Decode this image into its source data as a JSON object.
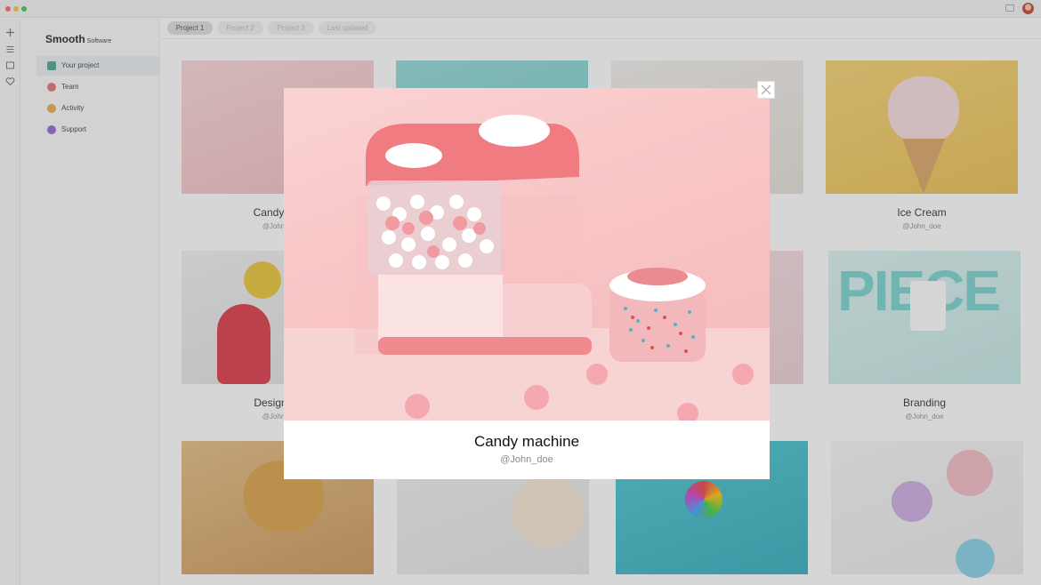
{
  "app": {
    "logo_text": "Smooth",
    "logo_sub": "Software"
  },
  "titlebar": {
    "mail_icon": "mail-icon",
    "avatar_icon": "user-avatar"
  },
  "rail": {
    "icons": [
      "plus-icon",
      "menu-icon",
      "square-icon",
      "heart-icon"
    ]
  },
  "sidebar": {
    "items": [
      {
        "label": "Your project",
        "icon": "briefcase-icon",
        "color": "#3aa28c"
      },
      {
        "label": "Team",
        "icon": "team-icon",
        "color": "#e06868"
      },
      {
        "label": "Activity",
        "icon": "activity-icon",
        "color": "#e7a43a"
      },
      {
        "label": "Support",
        "icon": "support-icon",
        "color": "#8a5cd1"
      }
    ]
  },
  "tabs": [
    "Project 1",
    "Project 2",
    "Project 3",
    "Last updated"
  ],
  "cards": [
    {
      "title": "Candy ma",
      "author": "@John_d",
      "color": "#f6c7cb"
    },
    {
      "title": "",
      "author": "",
      "color": "#7fd0cf"
    },
    {
      "title": "",
      "author": "",
      "color": "#ece9e5"
    },
    {
      "title": "Ice Cream",
      "author": "@John_doe",
      "color": "#f0c85c"
    },
    {
      "title": "Design int",
      "author": "@John_d",
      "color": "#e5e5e5"
    },
    {
      "title": "",
      "author": "",
      "color": "#eadfe2"
    },
    {
      "title": "",
      "author": "",
      "color": "#f3d6dc"
    },
    {
      "title": "Branding",
      "author": "@John_doe",
      "color": "#d4f0ee"
    },
    {
      "title": "",
      "author": "",
      "color": "#d5a868"
    },
    {
      "title": "",
      "author": "",
      "color": "#eeeeee"
    },
    {
      "title": "",
      "author": "",
      "color": "#33b3c4"
    },
    {
      "title": "",
      "author": "",
      "color": "#f1f1f1"
    }
  ],
  "modal": {
    "title": "Candy machine",
    "author": "@John_doe",
    "close_icon": "close-icon"
  }
}
